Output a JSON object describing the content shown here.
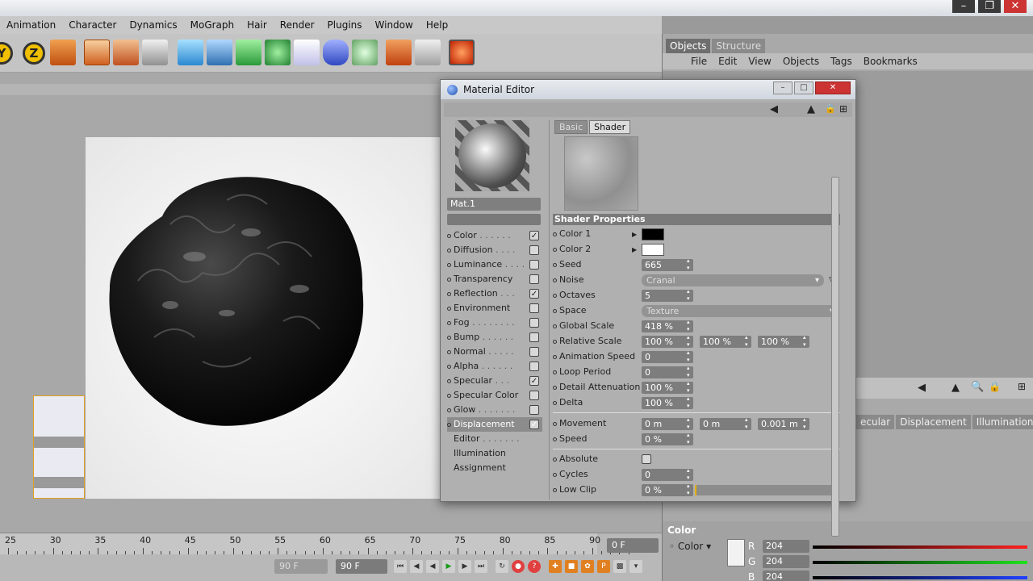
{
  "top_menu": [
    "Animation",
    "Character",
    "Dynamics",
    "MoGraph",
    "Hair",
    "Render",
    "Plugins",
    "Window",
    "Help"
  ],
  "toolbar": {
    "axis_y": "Y",
    "axis_z": "Z"
  },
  "timeline": {
    "ticks": [
      "25",
      "30",
      "35",
      "40",
      "45",
      "50",
      "55",
      "60",
      "65",
      "70",
      "75",
      "80",
      "85",
      "90"
    ],
    "current_frame": "0 F",
    "end_frame_left": "90 F",
    "end_frame": "90 F"
  },
  "right_panel": {
    "tabs": [
      "Objects",
      "Structure"
    ],
    "menu": [
      "File",
      "Edit",
      "View",
      "Objects",
      "Tags",
      "Bookmarks"
    ],
    "attr_tabs": [
      "ecular",
      "Displacement",
      "Illumination"
    ],
    "color_title": "Color",
    "color_label": "Color",
    "r_label": "R",
    "g_label": "G",
    "b_label": "B",
    "r_value": "204",
    "g_value": "204",
    "b_value": "204"
  },
  "material_editor": {
    "title": "Material Editor",
    "material_name": "Mat.1",
    "tabs": [
      "Basic",
      "Shader"
    ],
    "channels": [
      {
        "label": "Color",
        "dots": " . . . . . .",
        "checked": true
      },
      {
        "label": "Diffusion",
        "dots": " . . . .",
        "checked": false
      },
      {
        "label": "Luminance",
        "dots": " . . . .",
        "checked": false
      },
      {
        "label": "Transparency",
        "dots": "",
        "checked": false
      },
      {
        "label": "Reflection",
        "dots": " . . .",
        "checked": true
      },
      {
        "label": "Environment",
        "dots": "",
        "checked": false
      },
      {
        "label": "Fog",
        "dots": " . . . . . . . .",
        "checked": false
      },
      {
        "label": "Bump",
        "dots": " . . . . . .",
        "checked": false
      },
      {
        "label": "Normal",
        "dots": " . . . . .",
        "checked": false
      },
      {
        "label": "Alpha",
        "dots": " . . . . . .",
        "checked": false
      },
      {
        "label": "Specular",
        "dots": " . . .",
        "checked": true
      },
      {
        "label": "Specular Color",
        "dots": "",
        "checked": false
      },
      {
        "label": "Glow",
        "dots": " . . . . . . .",
        "checked": false
      },
      {
        "label": "Displacement",
        "dots": "",
        "checked": true
      }
    ],
    "extra_items": [
      "Editor",
      "Illumination",
      "Assignment"
    ],
    "editor_dots": " . . . . . . .",
    "check_mark": "✓",
    "section": "Shader Properties",
    "props": {
      "color1": "Color 1",
      "color2": "Color 2",
      "seed": "Seed",
      "seed_val": "665",
      "noise": "Noise",
      "noise_val": "Cranal",
      "octaves": "Octaves",
      "octaves_val": "5",
      "space": "Space",
      "space_val": "Texture",
      "global_scale": "Global Scale",
      "global_scale_val": "418 %",
      "relative_scale": "Relative Scale",
      "rel1": "100 %",
      "rel2": "100 %",
      "rel3": "100 %",
      "anim_speed": "Animation Speed",
      "anim_speed_val": "0",
      "loop_period": "Loop Period",
      "loop_period_val": "0",
      "detail_att": "Detail Attenuation",
      "detail_att_val": "100 %",
      "delta": "Delta",
      "delta_val": "100 %",
      "movement": "Movement",
      "mov1": "0 m",
      "mov2": "0 m",
      "mov3": "0.001 m",
      "speed": "Speed",
      "speed_val": "0 %",
      "absolute": "Absolute",
      "cycles": "Cycles",
      "cycles_val": "0",
      "low_clip": "Low Clip",
      "low_clip_val": "0 %"
    },
    "colors": {
      "color1": "#000000",
      "color2": "#ffffff"
    }
  }
}
